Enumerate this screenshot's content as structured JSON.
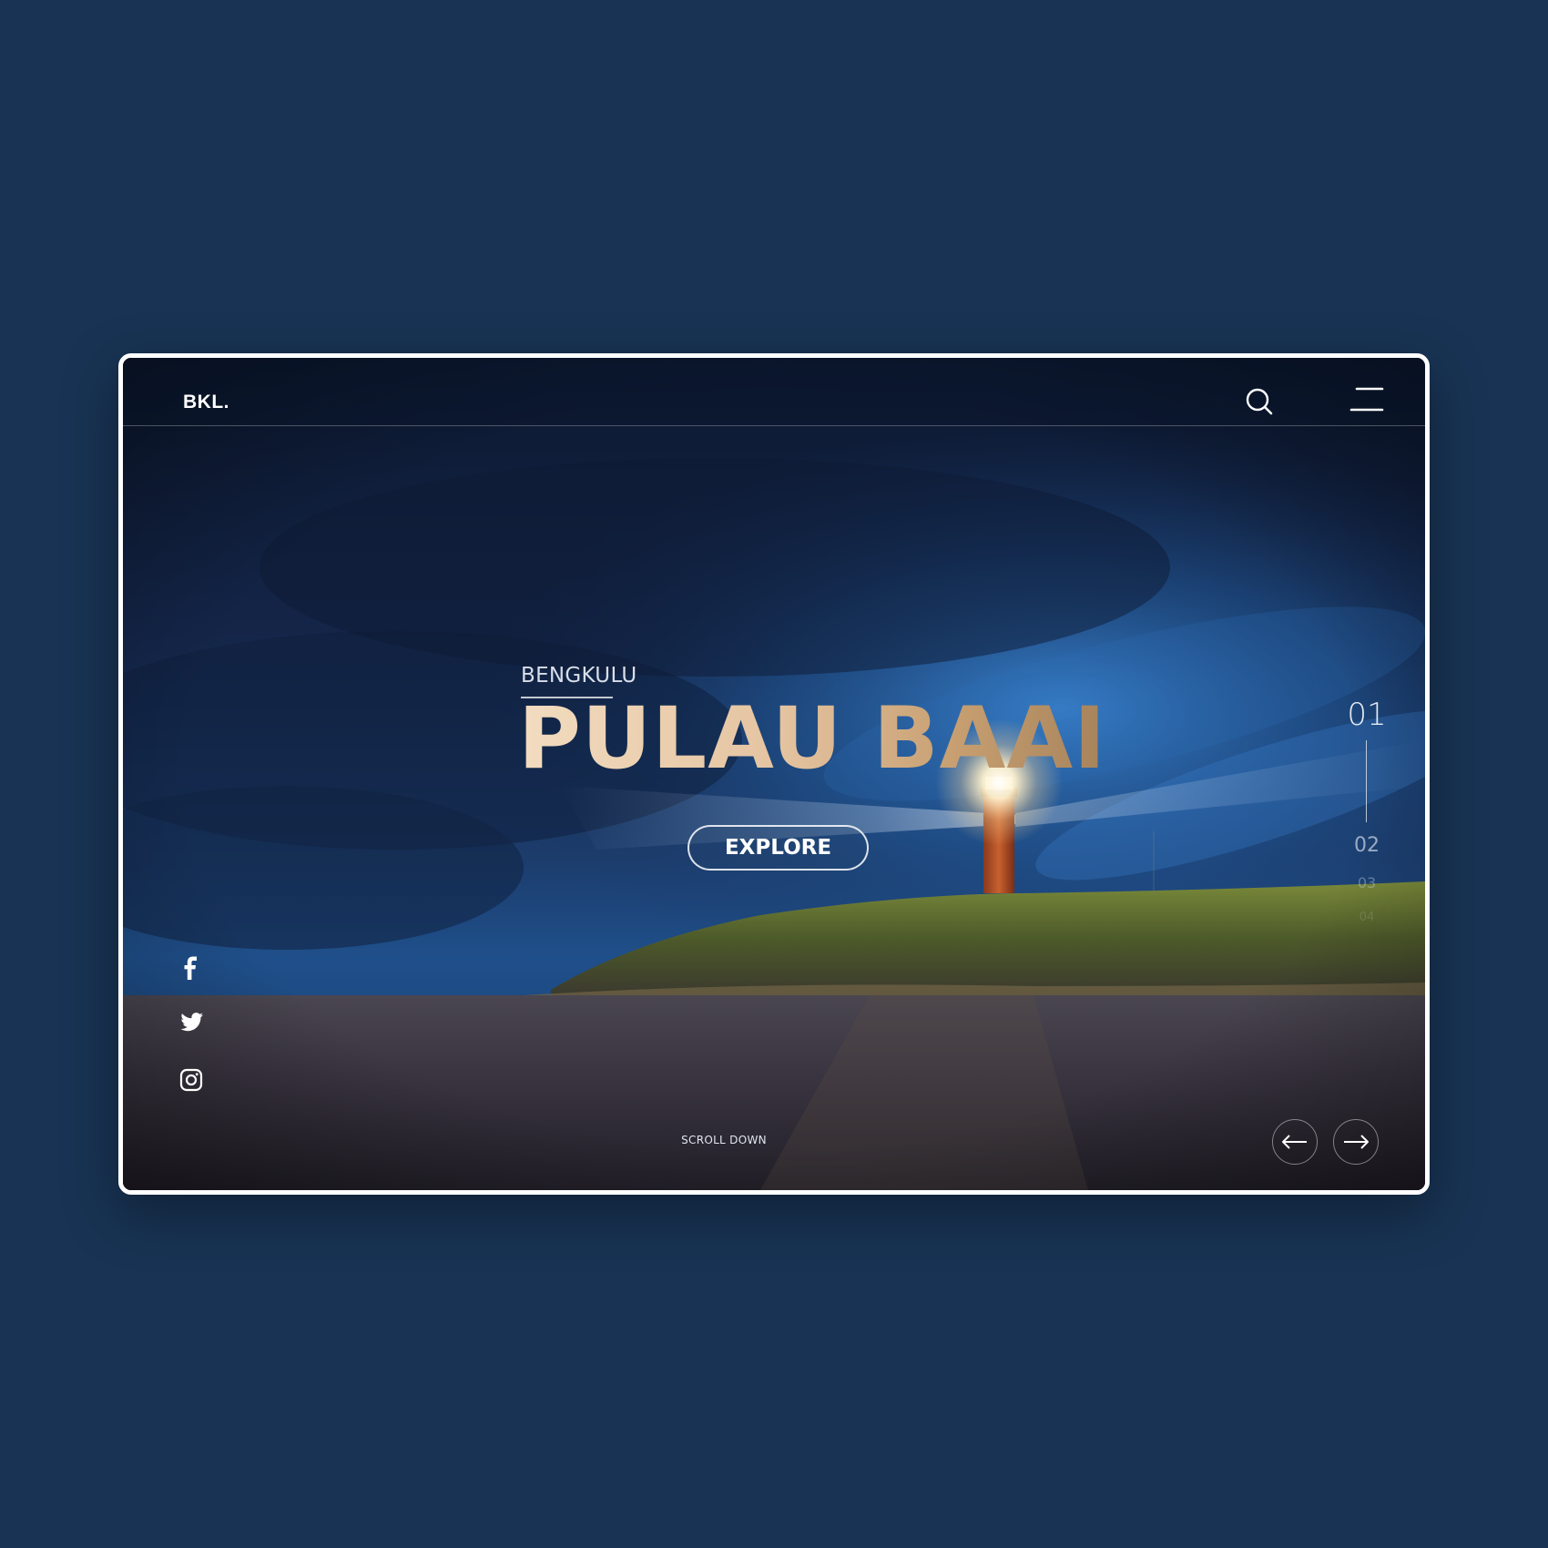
{
  "header": {
    "logo": "BKL.",
    "icons": [
      "search-icon",
      "menu-icon"
    ]
  },
  "hero": {
    "subtitle": "BENGKULU",
    "title": "PULAU BAAI",
    "explore_label": "EXPLORE"
  },
  "pager": {
    "items": [
      "01",
      "02",
      "03",
      "04"
    ],
    "active": "01"
  },
  "social": {
    "icons": [
      "facebook-icon",
      "twitter-icon",
      "instagram-icon"
    ]
  },
  "scroll_label": "SCROLL DOWN",
  "navigation": {
    "icons": [
      "arrow-left-icon",
      "arrow-right-icon"
    ]
  },
  "colors": {
    "page_background": "#183353",
    "frame_border": "#ffffff",
    "title_gradient_start": "#f2dcc0",
    "title_gradient_end": "#a7835b"
  }
}
